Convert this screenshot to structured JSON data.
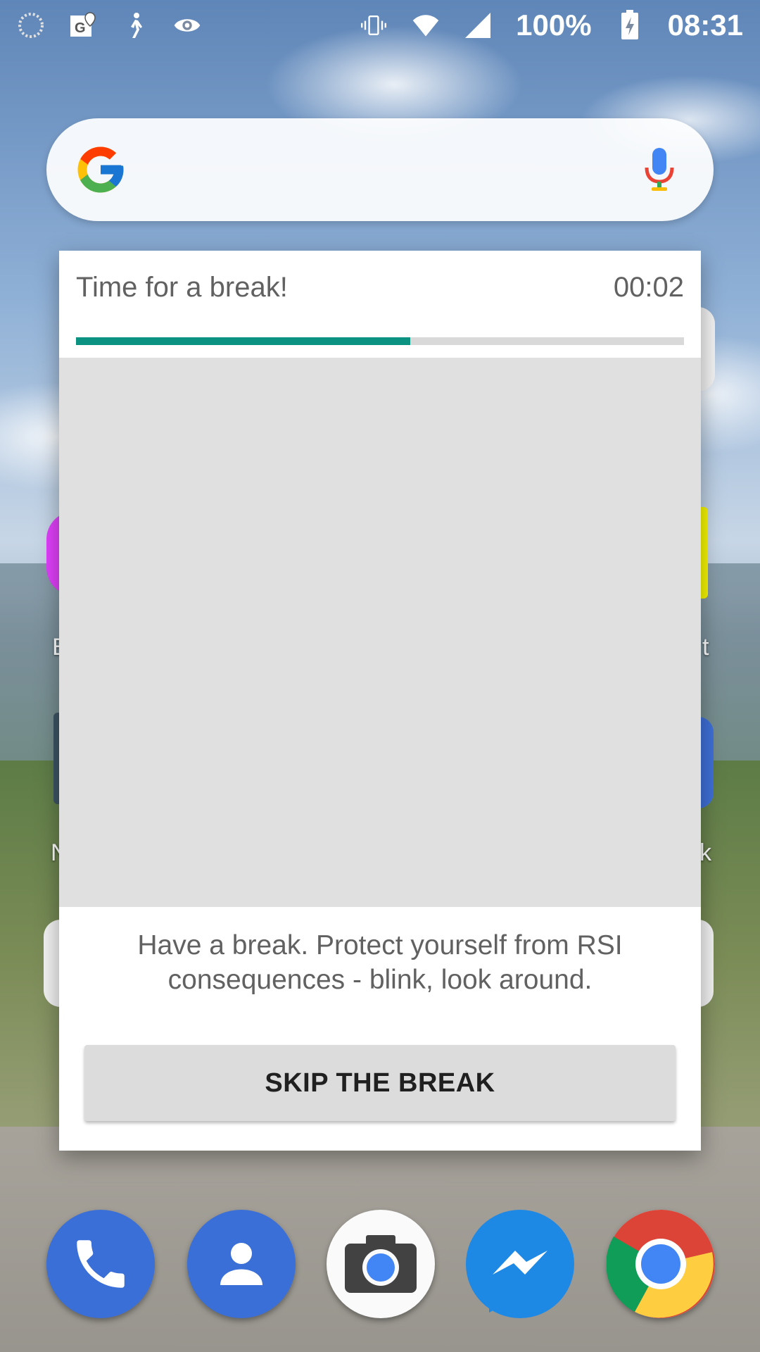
{
  "status_bar": {
    "battery": "100%",
    "time": "08:31",
    "left_icons": [
      "sync-icon",
      "maps-notification-icon",
      "walking-icon",
      "eye-icon"
    ],
    "right_icons": [
      "vibrate-icon",
      "wifi-icon",
      "signal-icon",
      "battery-charging-icon"
    ]
  },
  "search_bar": {
    "icons": [
      "google-logo-icon",
      "microphone-icon"
    ]
  },
  "dialog": {
    "title": "Time for a break!",
    "timer": "00:02",
    "progress": 0.55,
    "message": "Have a break. Protect yourself from RSI consequences - blink, look around.",
    "skip_button_label": "SKIP THE BREAK",
    "accent_color": "#0c9280"
  },
  "home_peek_labels": {
    "left_1": "E",
    "right_1": "t",
    "left_2": "N",
    "right_2": "k"
  },
  "dock": {
    "apps": [
      "phone-icon",
      "contacts-icon",
      "camera-icon",
      "messenger-icon",
      "chrome-icon"
    ]
  }
}
